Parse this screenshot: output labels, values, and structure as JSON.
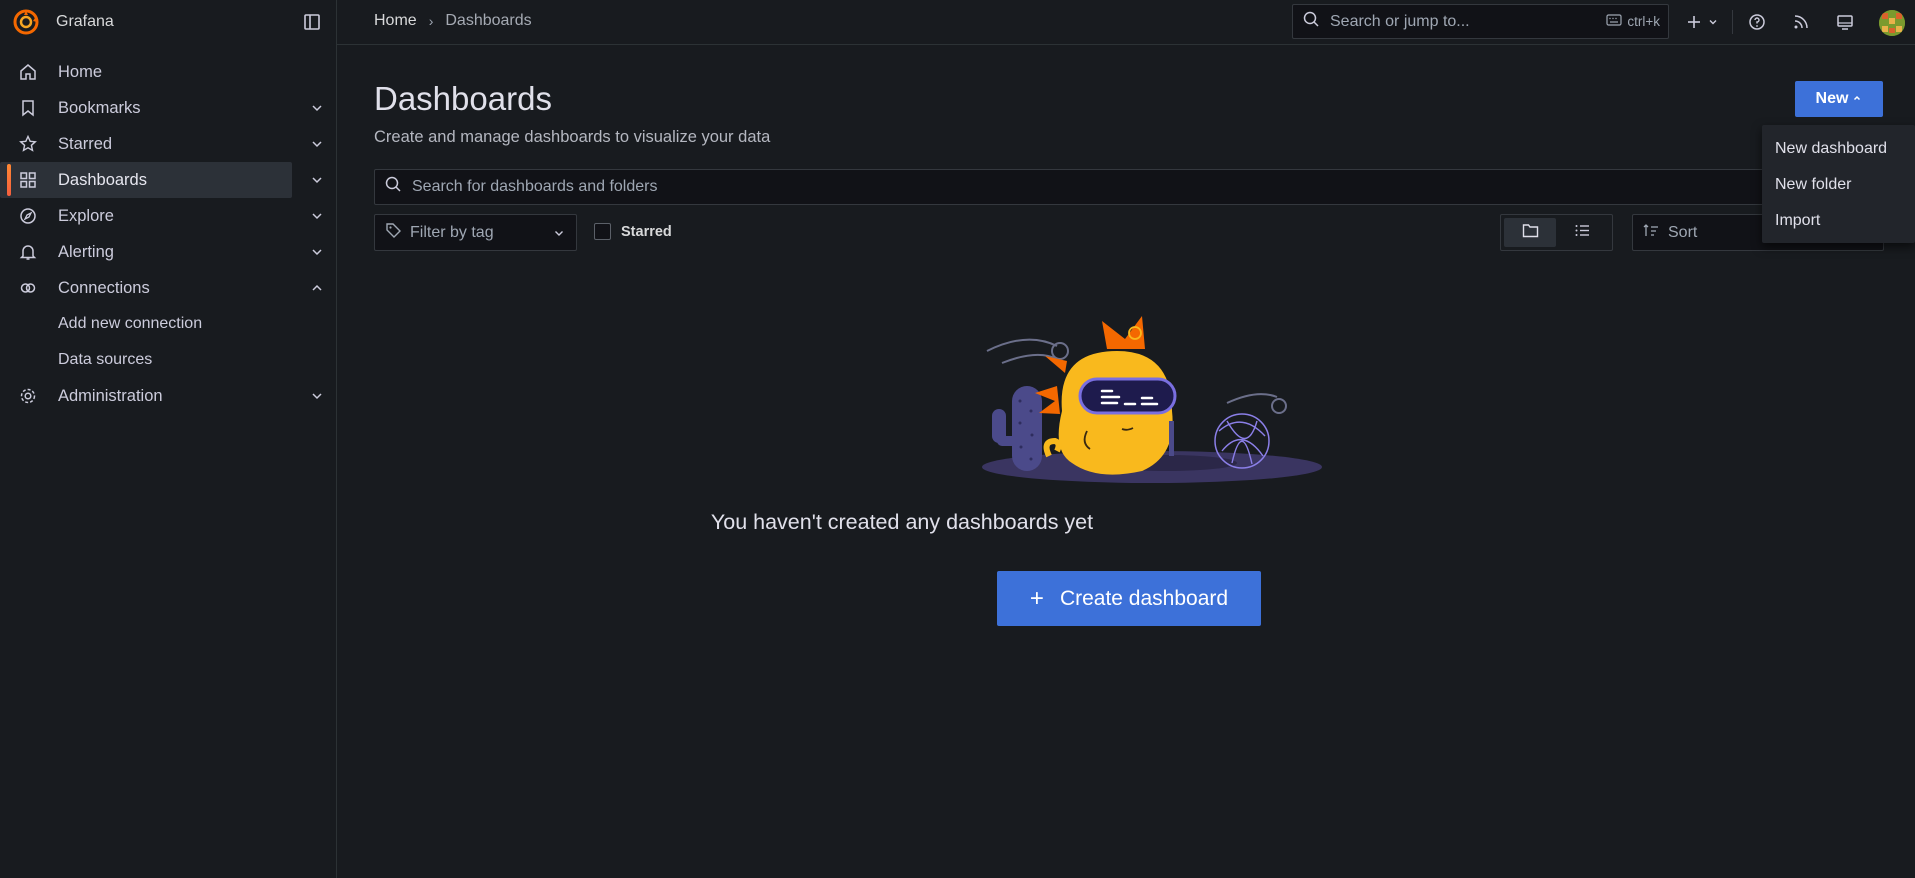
{
  "brand": {
    "name": "Grafana"
  },
  "sidebar": {
    "items": [
      {
        "label": "Home"
      },
      {
        "label": "Bookmarks"
      },
      {
        "label": "Starred"
      },
      {
        "label": "Dashboards"
      },
      {
        "label": "Explore"
      },
      {
        "label": "Alerting"
      },
      {
        "label": "Connections"
      },
      {
        "label": "Add new connection"
      },
      {
        "label": "Data sources"
      },
      {
        "label": "Administration"
      }
    ]
  },
  "topbar": {
    "breadcrumb": {
      "home": "Home",
      "separator": "›",
      "current": "Dashboards"
    },
    "search": {
      "placeholder": "Search or jump to...",
      "shortcut": "ctrl+k"
    }
  },
  "page": {
    "title": "Dashboards",
    "subtitle": "Create and manage dashboards to visualize your data",
    "new_button": "New",
    "search_placeholder": "Search for dashboards and folders",
    "filter_tag_placeholder": "Filter by tag",
    "starred_label": "Starred",
    "sort_placeholder": "Sort",
    "empty_message": "You haven't created any dashboards yet",
    "create_button": "Create dashboard"
  },
  "new_menu": {
    "items": [
      {
        "label": "New dashboard"
      },
      {
        "label": "New folder"
      },
      {
        "label": "Import"
      }
    ]
  },
  "colors": {
    "primary": "#3d71d9",
    "accent": "#f55f3e",
    "background": "#181b1f"
  }
}
